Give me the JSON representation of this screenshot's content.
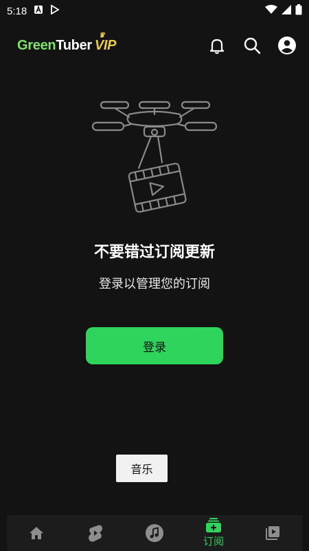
{
  "status_bar": {
    "time": "5:18"
  },
  "app_bar": {
    "logo_part1": "Green",
    "logo_part2": "Tuber",
    "logo_vip": "VIP"
  },
  "empty_state": {
    "headline": "不要错过订阅更新",
    "subline": "登录以管理您的订阅",
    "login_label": "登录"
  },
  "toast": {
    "text": "音乐"
  },
  "bottom_nav": {
    "active_label": "订阅",
    "items": [
      {
        "icon": "home-icon"
      },
      {
        "icon": "shorts-icon"
      },
      {
        "icon": "music-note-icon"
      },
      {
        "icon": "subscriptions-icon",
        "label": "订阅",
        "active": true
      },
      {
        "icon": "library-icon"
      }
    ]
  },
  "colors": {
    "background": "#131313",
    "accent_green": "#2ed45b",
    "logo_green": "#7fe36a",
    "vip_gold": "#e8c94a",
    "nav_background": "#1c1c1c"
  }
}
